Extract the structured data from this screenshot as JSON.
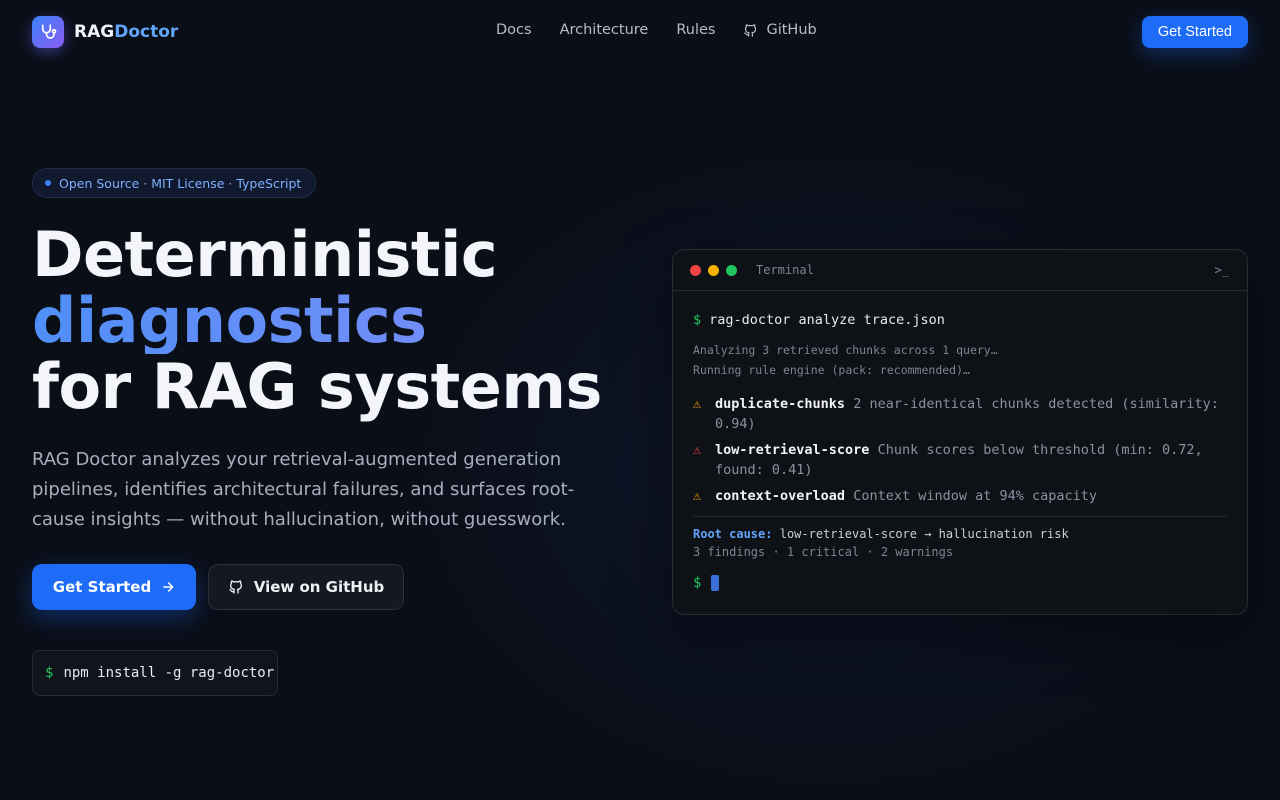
{
  "nav": {
    "brand_prefix": "RAG",
    "brand_suffix": "Doctor",
    "links": [
      {
        "label": "Docs"
      },
      {
        "label": "Architecture"
      },
      {
        "label": "Rules"
      },
      {
        "label": "GitHub",
        "icon": "github-icon"
      }
    ],
    "cta": "Get Started"
  },
  "hero": {
    "badge": "Open Source · MIT License · TypeScript",
    "headline_line1": "Deterministic",
    "headline_line2": "diagnostics",
    "headline_line3": "for RAG systems",
    "lead": "RAG Doctor analyzes your retrieval-augmented generation pipelines, identifies architectural failures, and surfaces root-cause insights — without hallucination, without guesswork.",
    "primary_button": "Get Started",
    "secondary_button": "View on GitHub",
    "install_prompt": "$",
    "install_command": "npm install -g rag-doctor"
  },
  "terminal": {
    "title": "Terminal",
    "prompt_icon": ">_",
    "prompt": "$",
    "command": "rag-doctor analyze trace.json",
    "status_lines": [
      "Analyzing 3 retrieved chunks across 1 query…",
      "Running rule engine (pack: recommended)…"
    ],
    "findings": [
      {
        "severity": "warning",
        "icon": "⚠",
        "name": "duplicate-chunks",
        "desc": "2 near-identical chunks detected (similarity: 0.94)"
      },
      {
        "severity": "critical",
        "icon": "⚠",
        "name": "low-retrieval-score",
        "desc": "Chunk scores below threshold (min: 0.72, found: 0.41)"
      },
      {
        "severity": "warning",
        "icon": "⚠",
        "name": "context-overload",
        "desc": "Context window at 94% capacity"
      }
    ],
    "root_cause_label": "Root cause:",
    "root_cause_value": "low-retrieval-score → hallucination risk",
    "summary": "3 findings · 1 critical · 2 warnings",
    "colors": {
      "warning": "#f59e0b",
      "critical": "#ef4444",
      "accent": "#1d6bf6",
      "prompt": "#22c55e"
    }
  }
}
